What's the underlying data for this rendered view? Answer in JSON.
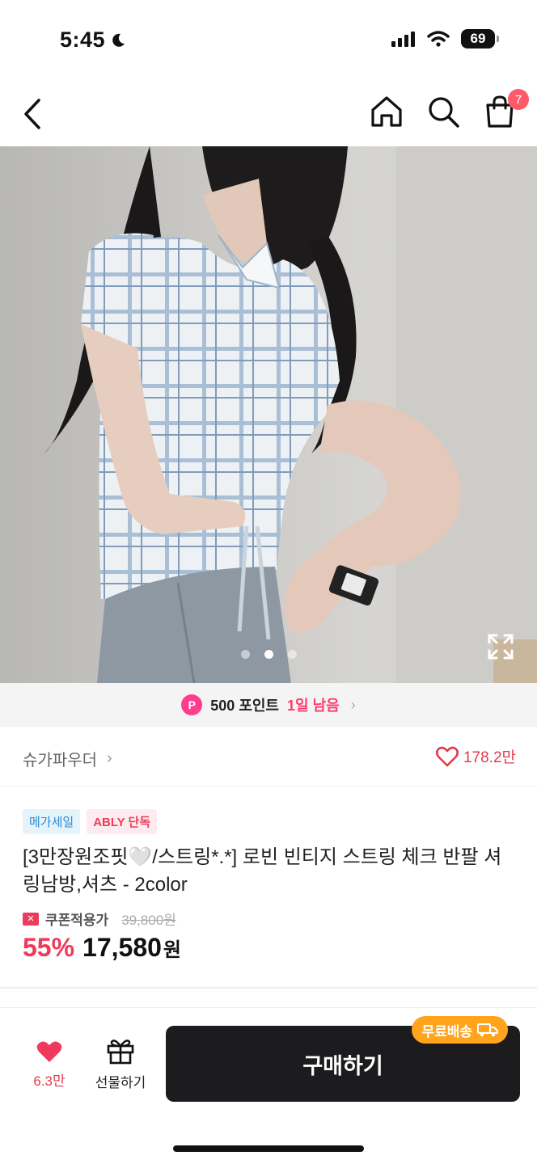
{
  "status_bar": {
    "time": "5:45",
    "battery": "69"
  },
  "header": {
    "cart_count": "7"
  },
  "gallery": {
    "page_count": 3,
    "current_page": 2
  },
  "points_banner": {
    "badge": "P",
    "points": "500 포인트",
    "remaining": "1일 남음",
    "chevron": "›"
  },
  "shop": {
    "name": "슈가파우더",
    "chevron": "›",
    "likes": "178.2만"
  },
  "product": {
    "tags": [
      "메가세일",
      "ABLY 단독"
    ],
    "title": "[3만장원조핏🤍/스트링*.*] 로빈 빈티지 스트링 체크 반팔 셔링남방,셔츠 - 2color",
    "coupon_label": "쿠폰적용가",
    "original_price": "39,800원",
    "discount": "55%",
    "sale_price": "17,580",
    "currency": "원"
  },
  "bottom_bar": {
    "like_count": "6.3만",
    "gift_label": "선물하기",
    "buy_label": "구매하기",
    "free_shipping": "무료배송"
  },
  "colors": {
    "accent_red": "#ee3b5b",
    "points_pink": "#ff3c8e",
    "free_ship_orange": "#ffa41c",
    "buy_button": "#1c1c1e"
  }
}
